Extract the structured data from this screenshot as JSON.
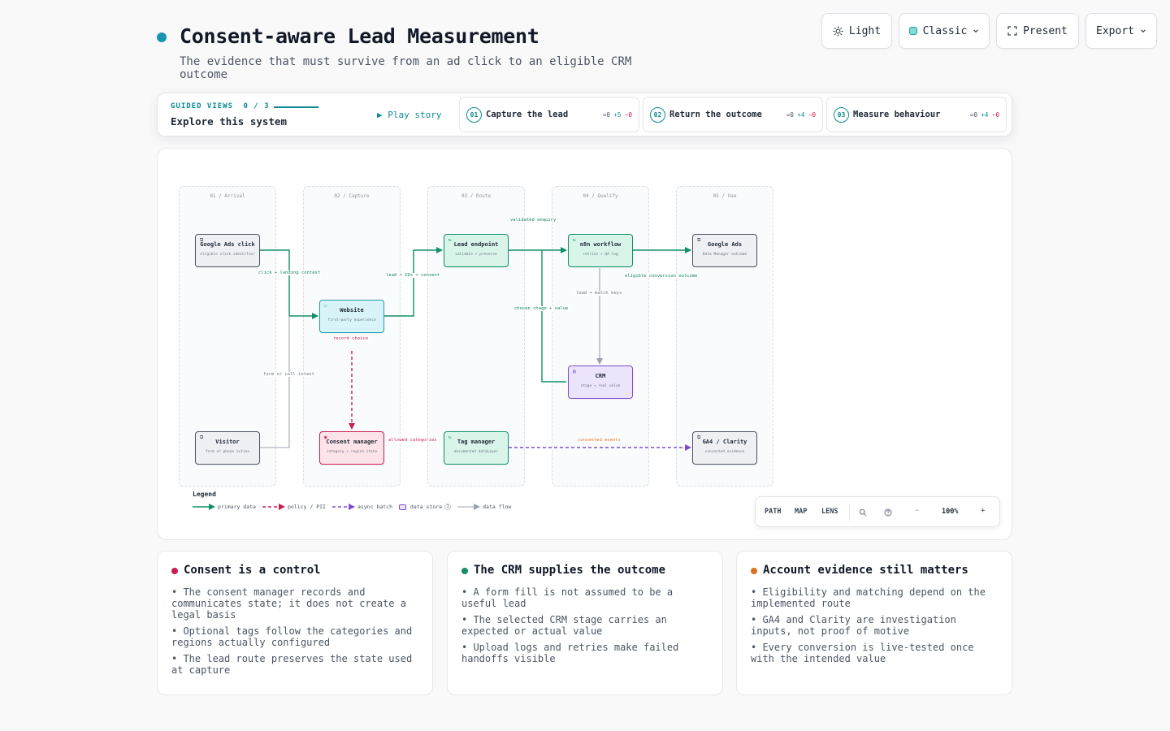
{
  "header": {
    "title": "Consent-aware Lead Measurement",
    "subtitle": "The evidence that must survive from an ad click to an eligible CRM outcome",
    "accent": "#1a93b3"
  },
  "toolbar": {
    "theme_label": "Light",
    "style_label": "Classic",
    "present_label": "Present",
    "export_label": "Export"
  },
  "guide": {
    "label": "GUIDED VIEWS",
    "progress": "0 / 3",
    "title": "Explore this system",
    "play_label": "▶ Play story",
    "steps": [
      {
        "num": "01",
        "label": "Capture the lead",
        "eq": "=0",
        "add": "+5",
        "rem": "−0"
      },
      {
        "num": "02",
        "label": "Return the outcome",
        "eq": "=0",
        "add": "+4",
        "rem": "−0"
      },
      {
        "num": "03",
        "label": "Measure behaviour",
        "eq": "=0",
        "add": "+4",
        "rem": "−0"
      }
    ]
  },
  "diagram": {
    "lanes": [
      "01 / Arrival",
      "02 / Capture",
      "03 / Route",
      "04 / Qualify",
      "05 / Use"
    ],
    "nodes": {
      "google_ads_click": {
        "title": "Google Ads click",
        "sub": "eligible click identifier"
      },
      "visitor": {
        "title": "Visitor",
        "sub": "form or phone action"
      },
      "website": {
        "title": "Website",
        "sub": "first-party experience"
      },
      "consent_manager": {
        "title": "Consent manager",
        "sub": "category + region state"
      },
      "lead_endpoint": {
        "title": "Lead endpoint",
        "sub": "validate + preserve"
      },
      "tag_manager": {
        "title": "Tag manager",
        "sub": "documented dataLayer"
      },
      "n8n_workflow": {
        "title": "n8n workflow",
        "sub": "retries + QA log"
      },
      "crm": {
        "title": "CRM",
        "sub": "stage + real value"
      },
      "google_ads": {
        "title": "Google Ads",
        "sub": "Data Manager outcome"
      },
      "ga4_clarity": {
        "title": "GA4 / Clarity",
        "sub": "consented evidence"
      }
    },
    "edge_labels": {
      "click_landing": "click + landing context",
      "form_call": "form or call intent",
      "lead_ids": "lead + IDs + consent",
      "record_choice": "record choice",
      "allowed_categories": "allowed categories",
      "validated_enquiry": "validated enquiry",
      "lead_match": "lead + match keys",
      "chosen_stage": "chosen stage + value",
      "eligible_outcome": "eligible conversion outcome",
      "consented_events": "consented events"
    },
    "legend": {
      "title": "Legend",
      "primary": "primary data",
      "policy": "policy / PII",
      "async": "async batch",
      "store": "data store",
      "store_count": "1",
      "flow": "data flow"
    },
    "colors": {
      "primary": "#129068",
      "policy": "#c81e4f",
      "async": "#7c4dcc",
      "flow": "#9ca3af"
    }
  },
  "controls": {
    "path": "PATH",
    "map": "MAP",
    "lens": "LENS",
    "zoom": "100%"
  },
  "cards": [
    {
      "title": "Consent is a control",
      "color": "#c81e4f",
      "items": [
        "• The consent manager records and communicates state; it does not create a legal basis",
        "• Optional tags follow the categories and regions actually configured",
        "• The lead route preserves the state used at capture"
      ]
    },
    {
      "title": "The CRM supplies the outcome",
      "color": "#129068",
      "items": [
        "• A form fill is not assumed to be a useful lead",
        "• The selected CRM stage carries an expected or actual value",
        "• Upload logs and retries make failed handoffs visible"
      ]
    },
    {
      "title": "Account evidence still matters",
      "color": "#d9701e",
      "items": [
        "• Eligibility and matching depend on the implemented route",
        "• GA4 and Clarity are investigation inputs, not proof of motive",
        "• Every conversion is live-tested once with the intended value"
      ]
    }
  ]
}
